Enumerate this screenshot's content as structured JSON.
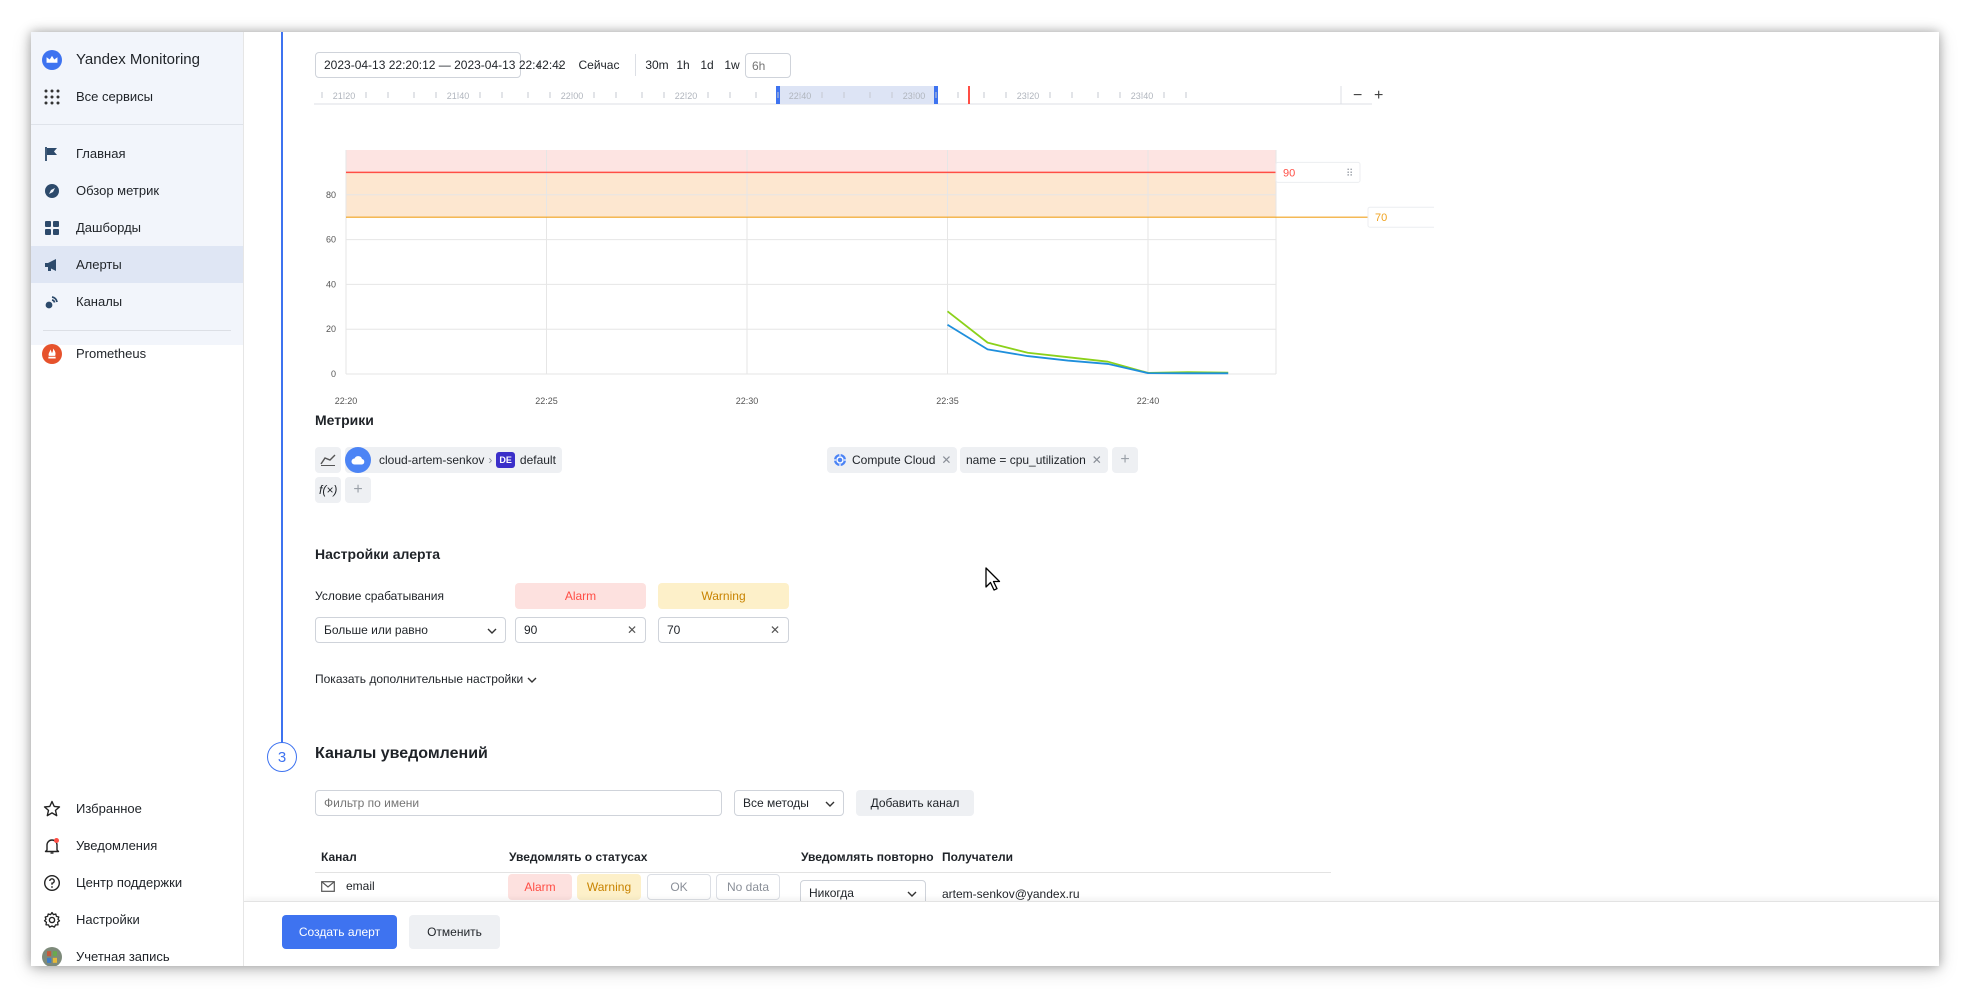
{
  "sidebar": {
    "brand": "Yandex Monitoring",
    "all_services": "Все сервисы",
    "nav": [
      {
        "label": "Главная",
        "icon": "flag-icon"
      },
      {
        "label": "Обзор метрик",
        "icon": "compass-icon"
      },
      {
        "label": "Дашборды",
        "icon": "dashboard-grid-icon"
      },
      {
        "label": "Алерты",
        "icon": "megaphone-icon",
        "active": true
      },
      {
        "label": "Каналы",
        "icon": "channels-icon"
      }
    ],
    "prometheus": "Prometheus",
    "bottom": [
      {
        "label": "Избранное",
        "icon": "star-icon"
      },
      {
        "label": "Уведомления",
        "icon": "bell-icon"
      },
      {
        "label": "Центр поддержки",
        "icon": "help-icon"
      },
      {
        "label": "Настройки",
        "icon": "gear-icon"
      },
      {
        "label": "Учетная запись",
        "icon": "avatar-icon"
      }
    ]
  },
  "time_controls": {
    "range": "2023-04-13 22:20:12 — 2023-04-13 22:42:42",
    "now": "Сейчас",
    "presets": [
      "30m",
      "1h",
      "1d",
      "1w"
    ],
    "custom_placeholder": "6h",
    "timeline_ticks": [
      "21:20",
      "21:40",
      "22:00",
      "22:20",
      "22:40",
      "23:00",
      "23:20",
      "23:40"
    ]
  },
  "chart_data": {
    "type": "line",
    "x_ticks": [
      "22:20",
      "22:25",
      "22:30",
      "22:35",
      "22:40"
    ],
    "y_ticks": [
      0,
      20,
      40,
      60,
      80
    ],
    "ylim": [
      0,
      100
    ],
    "thresholds": {
      "alarm": 90,
      "warning": 70
    },
    "x": [
      "22:35",
      "22:36",
      "22:37",
      "22:38",
      "22:39",
      "22:40",
      "22:41",
      "22:42"
    ],
    "series": [
      {
        "color": "#8bd11a",
        "values": [
          28,
          14,
          9.5,
          7.5,
          5.5,
          0.5,
          0.8,
          0.6
        ]
      },
      {
        "color": "#1f8fdc",
        "values": [
          22,
          11,
          8,
          6,
          4.5,
          0.4,
          0.3,
          0.3
        ]
      }
    ]
  },
  "metrics": {
    "title": "Метрики",
    "cloud": "cloud-artem-senkov",
    "folder_badge": "DE",
    "folder": "default",
    "service": "Compute Cloud",
    "selector": "name = cpu_utilization",
    "function_label": "f(×)"
  },
  "alert_settings": {
    "title": "Настройки алерта",
    "condition_label": "Условие срабатывания",
    "alarm_label": "Alarm",
    "warning_label": "Warning",
    "condition_value": "Больше или равно",
    "alarm_value": "90",
    "warning_value": "70",
    "more_settings": "Показать дополнительные настройки"
  },
  "notifications": {
    "step": "3",
    "title": "Каналы уведомлений",
    "filter_placeholder": "Фильтр по имени",
    "methods": "Все методы",
    "add_channel": "Добавить канал",
    "columns": [
      "Канал",
      "Уведомлять о статусах",
      "Уведомлять повторно",
      "Получатели"
    ],
    "row": {
      "channel": "email",
      "statuses": [
        "Alarm",
        "Warning",
        "OK",
        "No data"
      ],
      "repeat": "Никогда",
      "recipients": "artem-senkov@yandex.ru"
    }
  },
  "footer": {
    "create": "Создать алерт",
    "cancel": "Отменить"
  },
  "colors": {
    "accent": "#3e73f0",
    "alarm": "#ff4e45",
    "warning": "#f0a21e"
  }
}
